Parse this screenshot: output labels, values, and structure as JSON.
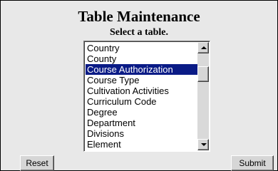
{
  "page": {
    "title": "Table Maintenance",
    "subtitle": "Select a table."
  },
  "table_list": {
    "items": [
      {
        "label": "Country",
        "selected": false
      },
      {
        "label": "County",
        "selected": false
      },
      {
        "label": "Course Authorization",
        "selected": true
      },
      {
        "label": "Course Type",
        "selected": false
      },
      {
        "label": "Cultivation Activities",
        "selected": false
      },
      {
        "label": "Curriculum Code",
        "selected": false
      },
      {
        "label": "Degree",
        "selected": false
      },
      {
        "label": "Department",
        "selected": false
      },
      {
        "label": "Divisions",
        "selected": false
      },
      {
        "label": "Element",
        "selected": false
      }
    ],
    "selection_color": "#0a1b86"
  },
  "buttons": {
    "reset_label": "Reset",
    "submit_label": "Submit"
  },
  "icons": {
    "scroll_up": "triangle-up-icon",
    "scroll_down": "triangle-down-icon"
  }
}
